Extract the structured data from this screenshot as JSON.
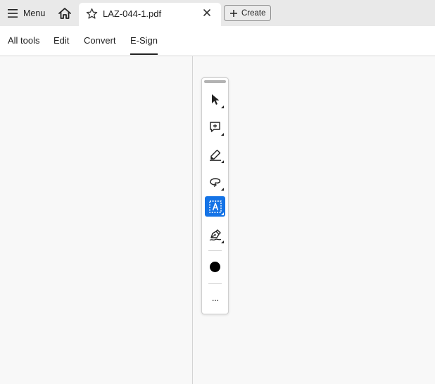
{
  "topbar": {
    "menu_label": "Menu",
    "home_icon": "home-icon",
    "document_tab": {
      "title": "LAZ-044-1.pdf",
      "star_icon": "star-icon",
      "close_icon": "close-icon"
    },
    "create_label": "Create"
  },
  "tools_tabs": [
    {
      "label": "All tools",
      "active": false
    },
    {
      "label": "Edit",
      "active": false
    },
    {
      "label": "Convert",
      "active": false
    },
    {
      "label": "E-Sign",
      "active": true
    }
  ],
  "quick_toolbar": {
    "tools": [
      {
        "name": "select-tool",
        "icon": "arrow-cursor-icon",
        "selected": false
      },
      {
        "name": "add-comment-tool",
        "icon": "comment-plus-icon",
        "selected": false
      },
      {
        "name": "highlight-tool",
        "icon": "pen-icon",
        "selected": false
      },
      {
        "name": "draw-freeform-tool",
        "icon": "lasso-icon",
        "selected": false
      },
      {
        "name": "text-field-tool",
        "icon": "text-box-icon",
        "selected": true
      },
      {
        "name": "sign-tool",
        "icon": "sign-pen-icon",
        "selected": false
      }
    ],
    "color_swatch": "#000000",
    "more_icon": "ellipsis-icon",
    "more_label": "···"
  },
  "colors": {
    "accent": "#1473e6",
    "topbar_bg": "#e9e9e9",
    "canvas_bg": "#f8f8f8"
  }
}
